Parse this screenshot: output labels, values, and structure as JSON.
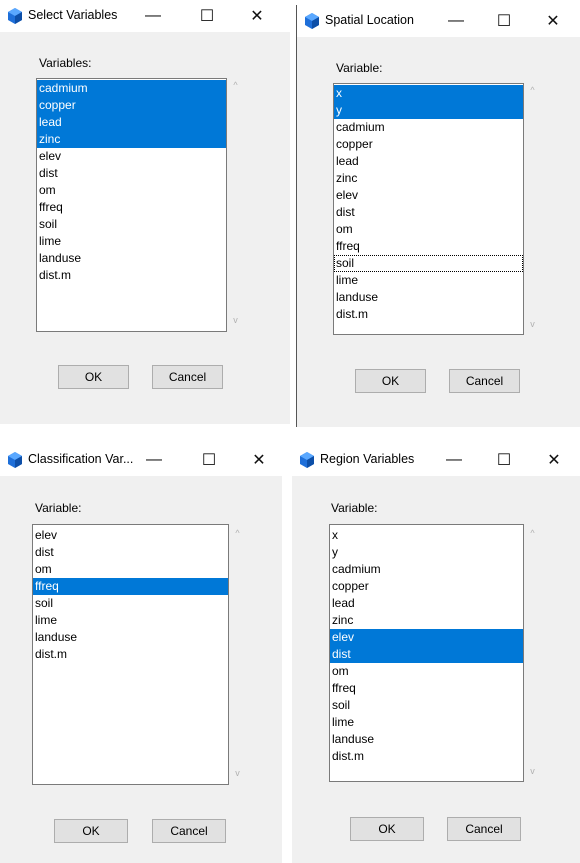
{
  "colors": {
    "selection": "#0078d7",
    "dialog_bg": "#f0f0f0"
  },
  "icons": {
    "app": "cube-icon",
    "minimize": "minimize-icon",
    "maximize": "maximize-icon",
    "close": "close-icon",
    "scroll_up": "chevron-up-icon",
    "scroll_down": "chevron-down-icon"
  },
  "window_controls": {
    "minimize": "—",
    "maximize": "☐",
    "close": "✕",
    "up": "^",
    "down": "v"
  },
  "dialogs": [
    {
      "title": "Select Variables",
      "label": "Variables:",
      "items": [
        "cadmium",
        "copper",
        "lead",
        "zinc",
        "elev",
        "dist",
        "om",
        "ffreq",
        "soil",
        "lime",
        "landuse",
        "dist.m"
      ],
      "selected": [
        "cadmium",
        "copper",
        "lead",
        "zinc"
      ],
      "ok": "OK",
      "cancel": "Cancel"
    },
    {
      "title": "Spatial Location",
      "label": "Variable:",
      "items": [
        "x",
        "y",
        "cadmium",
        "copper",
        "lead",
        "zinc",
        "elev",
        "dist",
        "om",
        "ffreq",
        "soil",
        "lime",
        "landuse",
        "dist.m"
      ],
      "selected": [
        "x",
        "y"
      ],
      "focused": "soil",
      "ok": "OK",
      "cancel": "Cancel"
    },
    {
      "title": "Classification Var...",
      "label": "Variable:",
      "items": [
        "elev",
        "dist",
        "om",
        "ffreq",
        "soil",
        "lime",
        "landuse",
        "dist.m"
      ],
      "selected": [
        "ffreq"
      ],
      "ok": "OK",
      "cancel": "Cancel"
    },
    {
      "title": "Region Variables",
      "label": "Variable:",
      "items": [
        "x",
        "y",
        "cadmium",
        "copper",
        "lead",
        "zinc",
        "elev",
        "dist",
        "om",
        "ffreq",
        "soil",
        "lime",
        "landuse",
        "dist.m"
      ],
      "selected": [
        "elev",
        "dist"
      ],
      "ok": "OK",
      "cancel": "Cancel"
    }
  ]
}
